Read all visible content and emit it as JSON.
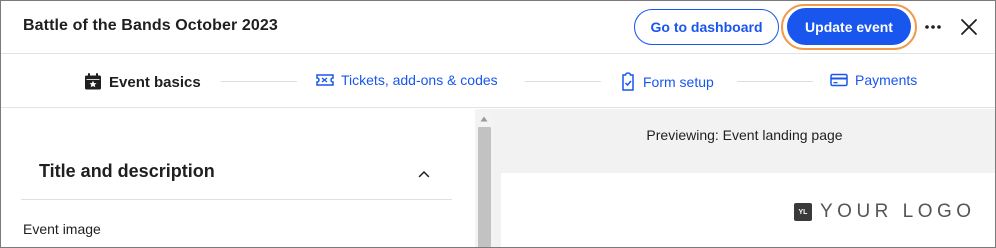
{
  "header": {
    "event_title": "Battle of the Bands October 2023",
    "dashboard_label": "Go to dashboard",
    "update_label": "Update event",
    "more_icon": "more-horizontal-icon",
    "close_icon": "close-icon"
  },
  "steps": [
    {
      "label": "Event basics",
      "icon": "calendar-star-icon",
      "active": true
    },
    {
      "label": "Tickets, add-ons & codes",
      "icon": "ticket-icon",
      "active": false
    },
    {
      "label": "Form setup",
      "icon": "form-check-icon",
      "active": false
    },
    {
      "label": "Payments",
      "icon": "credit-card-icon",
      "active": false
    }
  ],
  "editor": {
    "section_title": "Title and description",
    "event_image_label": "Event image"
  },
  "preview": {
    "label": "Previewing: Event landing page",
    "logo_badge": "YL",
    "logo_text": "YOUR LOGO"
  },
  "colors": {
    "accent": "#1856ed",
    "focus_ring": "#f29a4a",
    "preview_bg": "#f2f2f2",
    "scroll_thumb": "#c2c2c2"
  }
}
